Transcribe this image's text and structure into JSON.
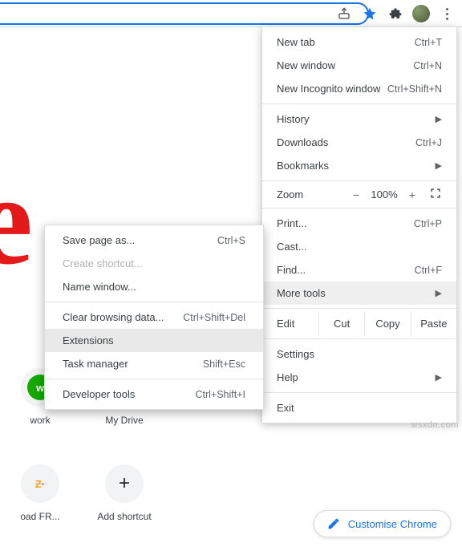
{
  "toolbar": {
    "share_icon": "share-icon",
    "star_icon": "bookmark-star-icon",
    "puzzle_icon": "extensions-puzzle-icon",
    "avatar_icon": "profile-avatar",
    "menu_icon": "kebab-menu-icon"
  },
  "menu": {
    "new_tab": {
      "label": "New tab",
      "shortcut": "Ctrl+T"
    },
    "new_window": {
      "label": "New window",
      "shortcut": "Ctrl+N"
    },
    "incognito": {
      "label": "New Incognito window",
      "shortcut": "Ctrl+Shift+N"
    },
    "history": {
      "label": "History"
    },
    "downloads": {
      "label": "Downloads",
      "shortcut": "Ctrl+J"
    },
    "bookmarks": {
      "label": "Bookmarks"
    },
    "zoom": {
      "label": "Zoom",
      "minus": "−",
      "value": "100%",
      "plus": "+"
    },
    "print": {
      "label": "Print...",
      "shortcut": "Ctrl+P"
    },
    "cast": {
      "label": "Cast..."
    },
    "find": {
      "label": "Find...",
      "shortcut": "Ctrl+F"
    },
    "more_tools": {
      "label": "More tools"
    },
    "edit": {
      "label": "Edit",
      "cut": "Cut",
      "copy": "Copy",
      "paste": "Paste"
    },
    "settings": {
      "label": "Settings"
    },
    "help": {
      "label": "Help"
    },
    "exit": {
      "label": "Exit"
    }
  },
  "submenu": {
    "save_page": {
      "label": "Save page as...",
      "shortcut": "Ctrl+S"
    },
    "create_shortcut": {
      "label": "Create shortcut..."
    },
    "name_window": {
      "label": "Name window..."
    },
    "clear_data": {
      "label": "Clear browsing data...",
      "shortcut": "Ctrl+Shift+Del"
    },
    "extensions": {
      "label": "Extensions"
    },
    "task_manager": {
      "label": "Task manager",
      "shortcut": "Shift+Esc"
    },
    "dev_tools": {
      "label": "Developer tools",
      "shortcut": "Ctrl+Shift+I"
    }
  },
  "shortcuts": {
    "upwork": {
      "label": "work"
    },
    "drive": {
      "label": "My Drive"
    },
    "freez": {
      "label": "oad FR..."
    },
    "add": {
      "label": "Add shortcut"
    }
  },
  "pill": {
    "label": "Customise Chrome"
  },
  "watermark": "wsxdn.com"
}
